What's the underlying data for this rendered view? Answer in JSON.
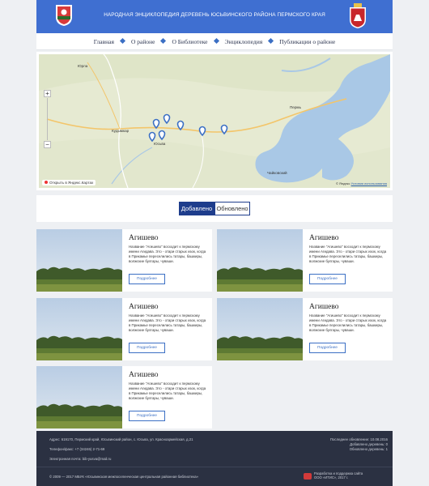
{
  "header": {
    "title": "НАРОДНАЯ ЭНЦИКЛОПЕДИЯ ДЕРЕВЕНЬ ЮСЬВИНСКОГО РАЙОНА ПЕРМСКОГО КРАЯ",
    "left_emblem_icon": "district-coat-of-arms-icon",
    "right_emblem_icon": "perm-krai-coat-of-arms-icon"
  },
  "nav": {
    "items": [
      {
        "label": "Главная"
      },
      {
        "label": "О районе"
      },
      {
        "label": "О Библиотеке"
      },
      {
        "label": "Энциклопедия"
      },
      {
        "label": "Публикации о районе"
      }
    ]
  },
  "map": {
    "labels": {
      "kudymkar": "Кудымкар",
      "yusva": "Юсьва",
      "pozhva": "Пожва",
      "north": "Юрла",
      "east": "Пермь",
      "southeast": "Чайковский"
    },
    "open_link": "Открыть в Яндекс.Картах",
    "copyright": "© Яндекс",
    "terms_link": "Условия использования"
  },
  "tabs": {
    "added": "Добавлено",
    "updated": "Обновлено"
  },
  "cards": [
    {
      "title": "Агишево",
      "description": "Название \"Агишево\" восходит к пермскому имени Агидава. Это - отари старых изок, когда в Прикамье переселились татары, башкиры, волжские булгары, чуваши.",
      "button": "Подробнее"
    },
    {
      "title": "Агишево",
      "description": "Название \"Агишево\" восходит к пермскому имени Агидава. Это - отари старых изок, когда в Прикамье переселились татары, башкиры, волжские булгары, чуваши.",
      "button": "Подробнее"
    },
    {
      "title": "Агишево",
      "description": "Название \"Агишево\" восходит к пермскому имени Агидава. Это - отари старых изок, когда в Прикамье переселились татары, башкиры, волжские булгары, чуваши.",
      "button": "Подробнее"
    },
    {
      "title": "Агишево",
      "description": "Название \"Агишево\" восходит к пермскому имени Агидава. Это - отари старых изок, когда в Прикамье переселились татары, башкиры, волжские булгары, чуваши.",
      "button": "Подробнее"
    },
    {
      "title": "Агишево",
      "description": "Название \"Агишево\" восходит к пермскому имени Агидава. Это - отари старых изок, когда в Прикамье переселились татары, башкиры, волжские булгары, чуваши.",
      "button": "Подробнее"
    }
  ],
  "footer": {
    "address": "Адрес: 619170, Пермский край, Юсьвинский район, с. Юсьва, ул. Красноармейская, д.21",
    "phone": "Телефон/факс: +7 (34246) 2-71-69",
    "email": "Электронная почта: bib-yusva@mail.ru",
    "last_update": "Последнее обновление: 10.08.2016",
    "villages_added": "Добавлено деревень: 0",
    "villages_updated": "Обновлено деревень: 1",
    "copyright": "© 2009 — 2017 МБУК «Юсьвинская межпоселенческая центральная районная библиотека»",
    "dev_line1": "Разработка и поддержка сайта",
    "dev_line2": "ООО «ИТИС», 2017 г."
  },
  "colors": {
    "header_blue": "#3f6fd1",
    "active_tab": "#1e3d8c",
    "accent": "#3b6fc4",
    "footer_bg": "#2b3142"
  }
}
